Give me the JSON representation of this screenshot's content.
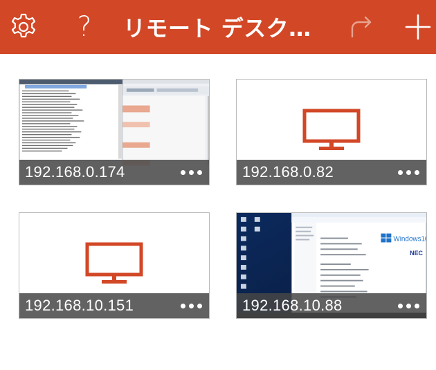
{
  "header": {
    "title": "リモート デスク…",
    "settings_icon": "gear-icon",
    "help_icon": "help-icon",
    "help_glyph": "?",
    "redo_icon": "redo-icon",
    "add_icon": "plus-icon",
    "background": "#d24726"
  },
  "connections": [
    {
      "host": "192.168.0.174",
      "thumbnail": "screenshot-terminal"
    },
    {
      "host": "192.168.0.82",
      "thumbnail": "monitor-icon"
    },
    {
      "host": "192.168.10.151",
      "thumbnail": "monitor-icon"
    },
    {
      "host": "192.168.10.88",
      "thumbnail": "screenshot-windows10"
    }
  ],
  "thumbnail_4": {
    "brand": "Windows10",
    "vendor": "NEC"
  },
  "accent": "#d24726"
}
